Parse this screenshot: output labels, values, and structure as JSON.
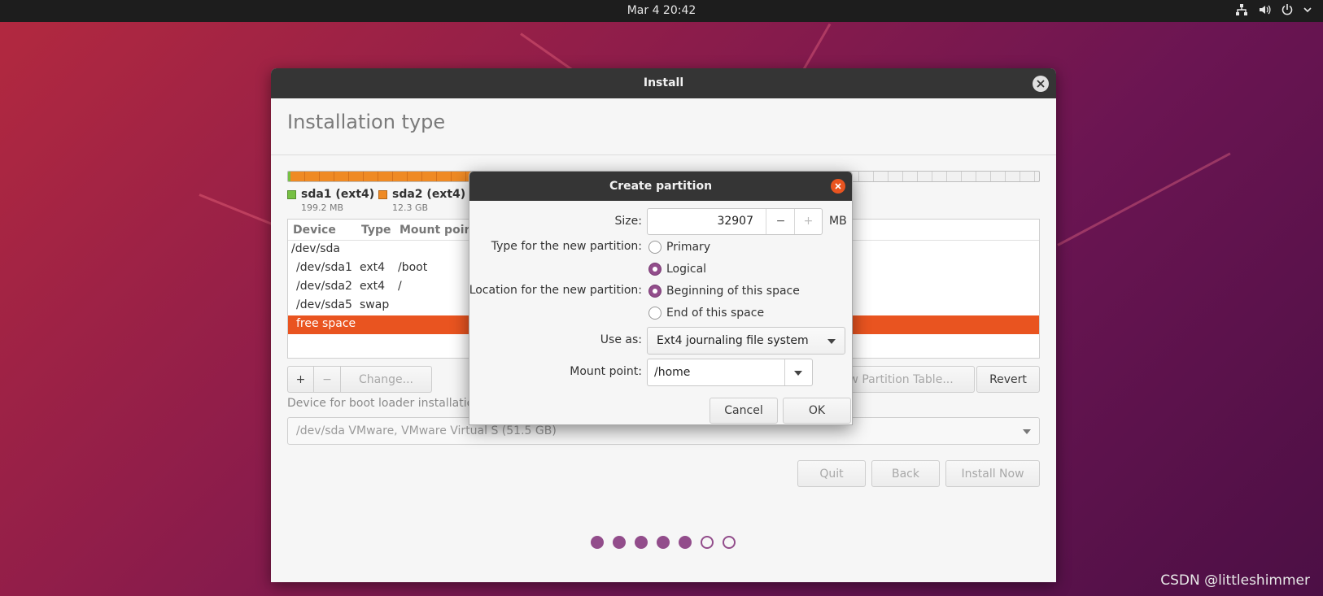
{
  "topbar": {
    "datetime": "Mar 4  20:42"
  },
  "window": {
    "title": "Install",
    "heading": "Installation type",
    "legend": [
      {
        "name": "sda1 (ext4)",
        "size": "199.2 MB",
        "color": "#76c043"
      },
      {
        "name": "sda2 (ext4)",
        "size": "12.3 GB",
        "color": "#ef8a24"
      }
    ],
    "table": {
      "headers": {
        "device": "Device",
        "type": "Type",
        "mount": "Mount point"
      },
      "rows": [
        {
          "device": "/dev/sda",
          "type": "",
          "mount": ""
        },
        {
          "device": "/dev/sda1",
          "type": "ext4",
          "mount": "/boot"
        },
        {
          "device": "/dev/sda2",
          "type": "ext4",
          "mount": "/"
        },
        {
          "device": "/dev/sda5",
          "type": "swap",
          "mount": ""
        },
        {
          "device": "free space",
          "type": "",
          "mount": ""
        }
      ]
    },
    "buttons": {
      "add": "+",
      "remove": "−",
      "change": "Change...",
      "new_table": "New Partition Table...",
      "revert": "Revert",
      "quit": "Quit",
      "back": "Back",
      "install_now": "Install Now"
    },
    "boot_loader": {
      "label": "Device for boot loader installation:",
      "value": "/dev/sda   VMware, VMware Virtual S (51.5 GB)"
    },
    "progress": {
      "total_steps": 7,
      "completed_steps": 5
    }
  },
  "dialog": {
    "title": "Create partition",
    "size_label": "Size:",
    "size_value": "32907",
    "size_unit": "MB",
    "minus": "−",
    "plus": "+",
    "type_label": "Type for the new partition:",
    "type_primary": "Primary",
    "type_logical": "Logical",
    "location_label": "Location for the new partition:",
    "location_beginning": "Beginning of this space",
    "location_end": "End of this space",
    "use_as_label": "Use as:",
    "use_as_value": "Ext4 journaling file system",
    "mount_label": "Mount point:",
    "mount_value": "/home",
    "cancel": "Cancel",
    "ok": "OK",
    "selected_type": "Logical",
    "selected_location": "Beginning of this space"
  },
  "watermark": "CSDN @littleshimmer",
  "colors": {
    "accent": "#e95420",
    "aubergine": "#924d8b",
    "titlebar": "#353535"
  }
}
